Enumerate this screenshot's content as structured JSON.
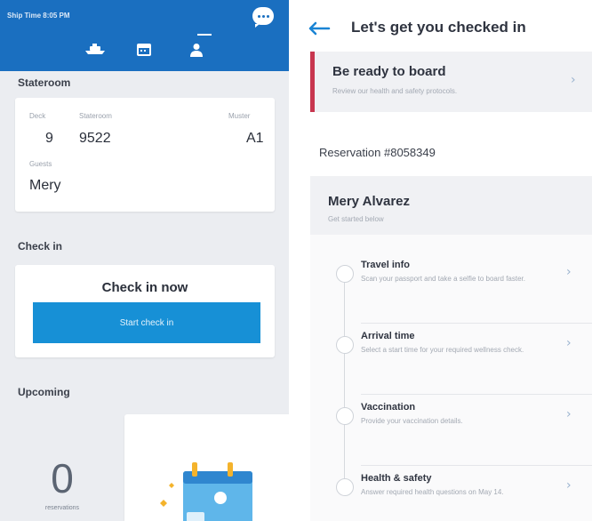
{
  "left_panel": {
    "status_time": "Ship Time 8:05 PM",
    "stateroom_section": "Stateroom",
    "stateroom": {
      "deck_label": "Deck",
      "deck_value": "9",
      "stateroom_label": "Stateroom",
      "stateroom_value": "9522",
      "muster_label": "Muster",
      "muster_value": "A1",
      "guests_label": "Guests",
      "guests_value": "Mery"
    },
    "checkin_section": "Check in",
    "checkin_title": "Check in now",
    "start_button": "Start check in",
    "upcoming_section": "Upcoming",
    "reservation_count": "0",
    "reservation_count_label": "reservations"
  },
  "right_panel": {
    "title": "Let's get you checked in",
    "board_card": {
      "title": "Be ready to board",
      "subtitle": "Review our health and safety protocols."
    },
    "reservation": "Reservation #8058349",
    "guest": {
      "name": "Mery Alvarez",
      "subtitle": "Get started below"
    },
    "steps": [
      {
        "title": "Travel info",
        "desc": "Scan your passport and take a selfie to board faster."
      },
      {
        "title": "Arrival time",
        "desc": "Select a start time for your required wellness check."
      },
      {
        "title": "Vaccination",
        "desc": "Provide your vaccination details."
      },
      {
        "title": "Health & safety",
        "desc": "Answer required health questions on May 14."
      }
    ]
  },
  "colors": {
    "brand_blue": "#1a6fc0",
    "button_blue": "#1790d6",
    "alert_red": "#c8364f"
  },
  "icons": [
    "chat-icon",
    "ship-icon",
    "calendar-icon",
    "person-icon",
    "back-arrow-icon",
    "chevron-right-icon",
    "calendar-illustration"
  ]
}
